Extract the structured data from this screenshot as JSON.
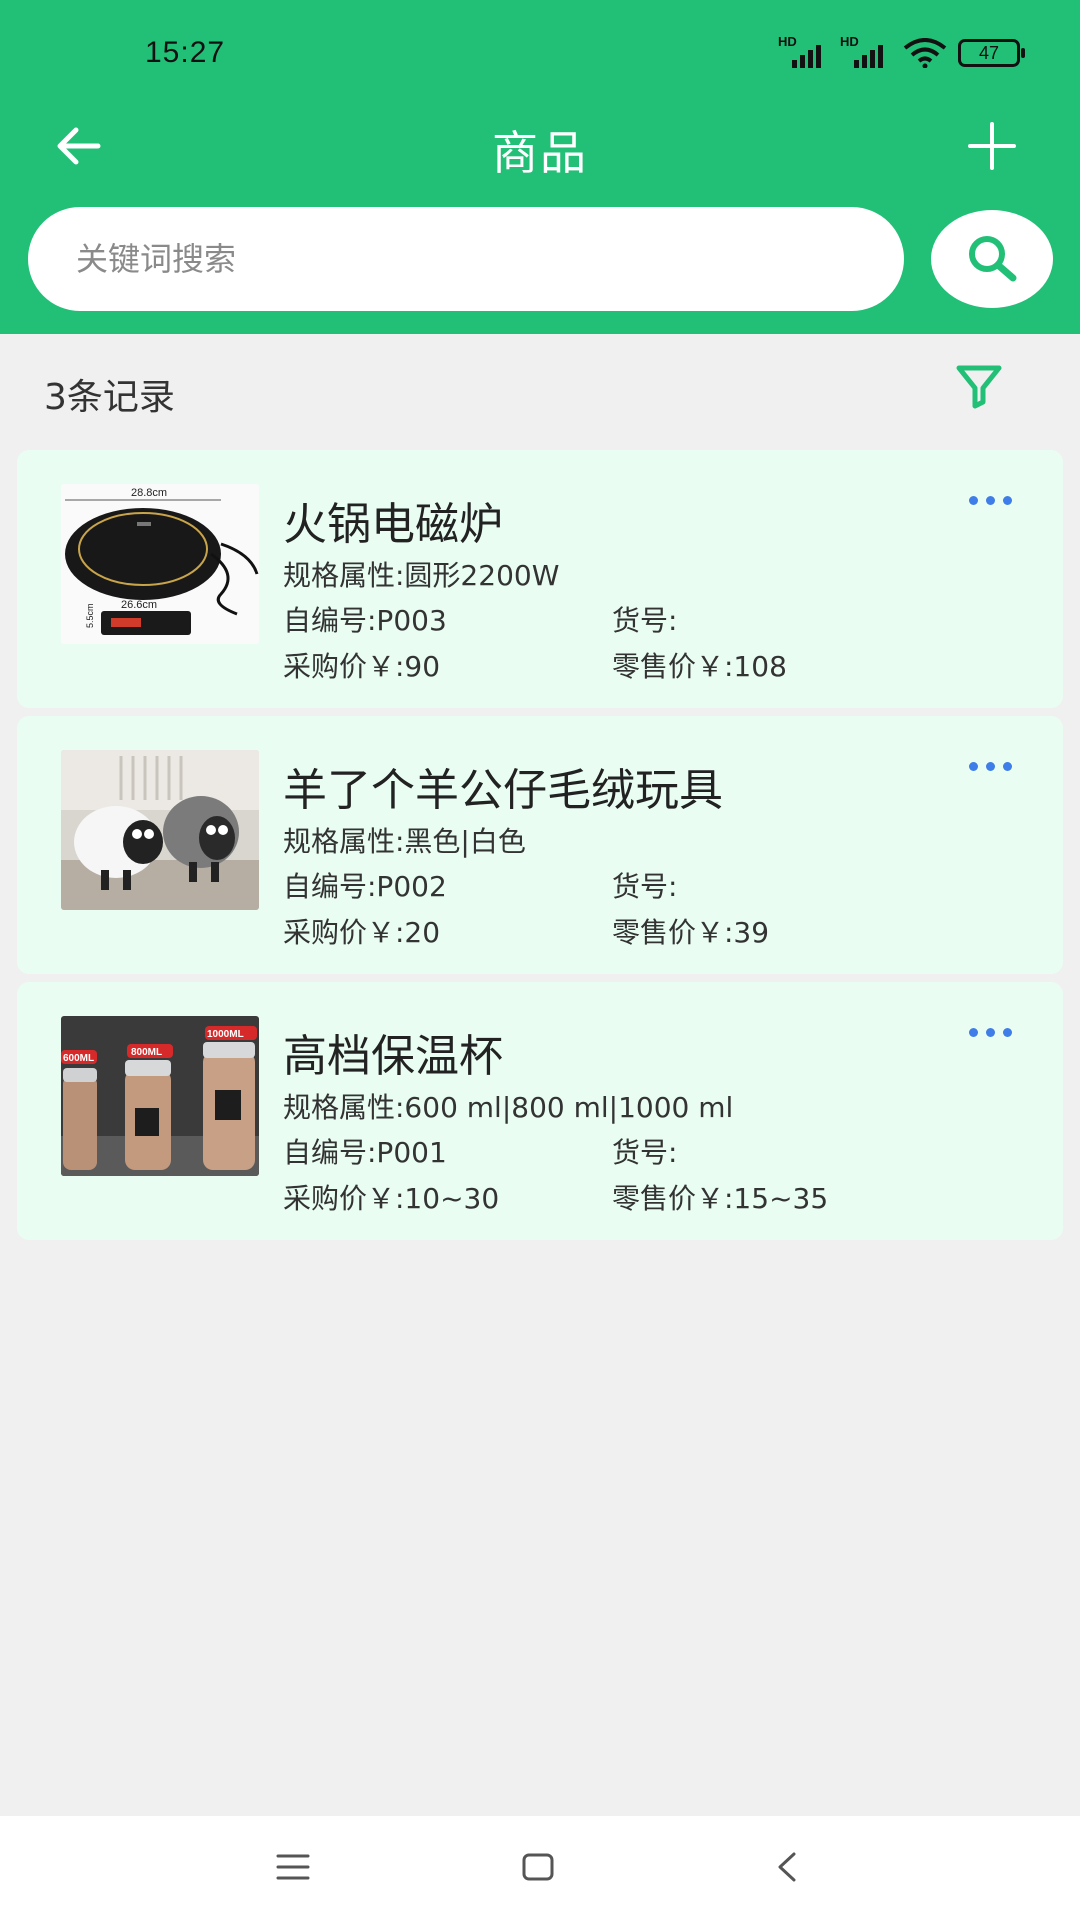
{
  "status_bar": {
    "time": "15:27",
    "network_label": "HD",
    "battery": "47"
  },
  "header": {
    "title": "商品"
  },
  "search": {
    "placeholder": "关键词搜索",
    "value": ""
  },
  "list": {
    "record_count": "3条记录",
    "items": [
      {
        "name": "火锅电磁炉",
        "spec": "规格属性:圆形2200W",
        "code": "自编号:P003",
        "goods_no": "货号:",
        "purchase_price": "采购价￥:90",
        "retail_price": "零售价￥:108",
        "image_text": {
          "top": "28.8cm",
          "mid": "26.6cm",
          "side": "5.5cm"
        }
      },
      {
        "name": "羊了个羊公仔毛绒玩具",
        "spec": "规格属性:黑色|白色",
        "code": "自编号:P002",
        "goods_no": "货号:",
        "purchase_price": "采购价￥:20",
        "retail_price": "零售价￥:39"
      },
      {
        "name": "高档保温杯",
        "spec": "规格属性:600 ml|800 ml|1000 ml",
        "code": "自编号:P001",
        "goods_no": "货号:",
        "purchase_price": "采购价￥:10~30",
        "retail_price": "零售价￥:15~35",
        "image_text": {
          "a": "600ML",
          "b": "800ML",
          "c": "1000ML"
        }
      }
    ]
  },
  "colors": {
    "primary": "#22bf77",
    "card_bg": "#e9fdf3",
    "more_dots": "#3f7ee8",
    "page_bg": "#f0f0f0"
  },
  "icons": [
    "back-arrow-icon",
    "plus-icon",
    "search-icon",
    "filter-icon",
    "more-icon",
    "menu-icon",
    "home-icon",
    "nav-back-icon"
  ]
}
